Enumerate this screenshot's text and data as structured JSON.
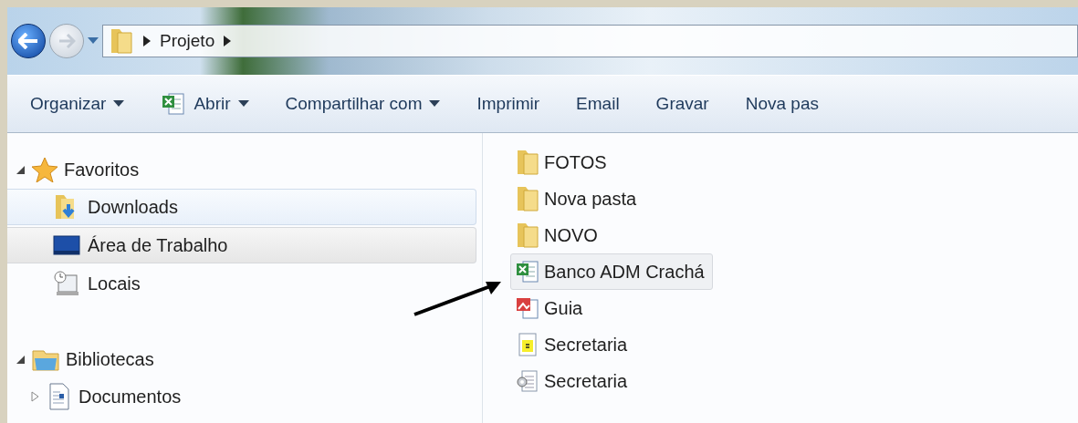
{
  "address_bar": {
    "path": [
      {
        "label": "Projeto"
      }
    ]
  },
  "toolbar": [
    {
      "label": "Organizar",
      "dropdown": true
    },
    {
      "label": "Abrir",
      "kind": "excel",
      "dropdown": true
    },
    {
      "label": "Compartilhar com",
      "dropdown": true
    },
    {
      "label": "Imprimir",
      "dropdown": false
    },
    {
      "label": "Email",
      "dropdown": false
    },
    {
      "label": "Gravar",
      "dropdown": false
    },
    {
      "label": "Nova pas",
      "dropdown": false
    }
  ],
  "sidebar": {
    "groups": [
      {
        "label": "Favoritos",
        "kind": "star",
        "expanded": true,
        "children": [
          {
            "label": "Downloads",
            "kind": "downloads",
            "selected": false,
            "hovered": true
          },
          {
            "label": "Área de Trabalho",
            "kind": "desktop",
            "selected": true,
            "hovered": false
          },
          {
            "label": "Locais",
            "kind": "places",
            "selected": false,
            "hovered": false
          }
        ]
      },
      {
        "label": "Bibliotecas",
        "kind": "library",
        "expanded": true,
        "children": [
          {
            "label": "Documentos",
            "kind": "document",
            "selected": false,
            "hovered": false,
            "expandable": true
          }
        ]
      }
    ]
  },
  "files": [
    {
      "name": "FOTOS",
      "kind": "folder",
      "selected": false
    },
    {
      "name": "Nova pasta",
      "kind": "folder",
      "selected": false
    },
    {
      "name": "NOVO",
      "kind": "folder",
      "selected": false
    },
    {
      "name": "Banco ADM Crachá",
      "kind": "excel",
      "selected": true
    },
    {
      "name": "Guia",
      "kind": "image",
      "selected": false
    },
    {
      "name": "Secretaria",
      "kind": "note",
      "selected": false
    },
    {
      "name": "Secretaria",
      "kind": "config",
      "selected": false
    }
  ]
}
